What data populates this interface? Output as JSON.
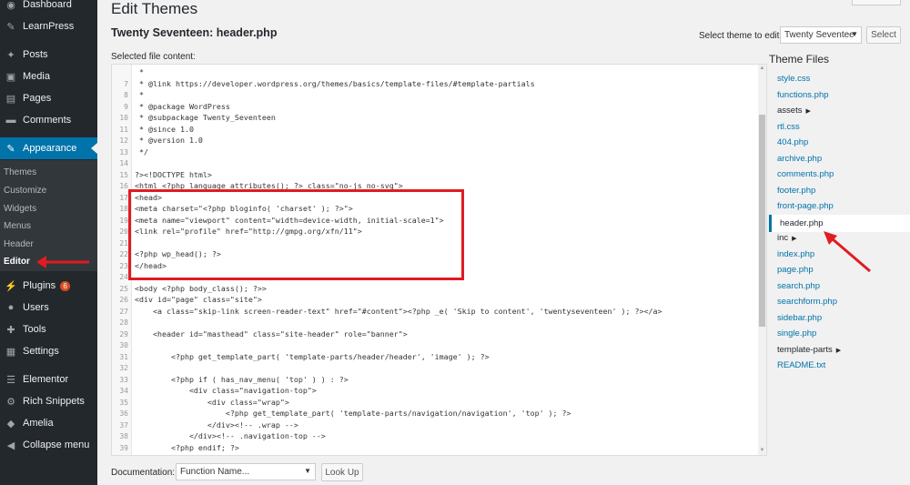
{
  "sidebar": {
    "items": [
      {
        "label": "Dashboard",
        "icon": "dashboard-icon",
        "glyph": "◉"
      },
      {
        "label": "LearnPress",
        "icon": "learnpress-icon",
        "glyph": "✎"
      },
      {
        "label": "Posts",
        "icon": "pin-icon",
        "glyph": "✦"
      },
      {
        "label": "Media",
        "icon": "media-icon",
        "glyph": "▣"
      },
      {
        "label": "Pages",
        "icon": "pages-icon",
        "glyph": "▤"
      },
      {
        "label": "Comments",
        "icon": "comments-icon",
        "glyph": "▬"
      },
      {
        "label": "Appearance",
        "icon": "paintbrush-icon",
        "glyph": "✎"
      },
      {
        "label": "Plugins",
        "icon": "plugin-icon",
        "glyph": "⚡",
        "badge": "6"
      },
      {
        "label": "Users",
        "icon": "users-icon",
        "glyph": "●"
      },
      {
        "label": "Tools",
        "icon": "wrench-icon",
        "glyph": "✚"
      },
      {
        "label": "Settings",
        "icon": "settings-icon",
        "glyph": "▦"
      },
      {
        "label": "Elementor",
        "icon": "elementor-icon",
        "glyph": "☰"
      },
      {
        "label": "Rich Snippets",
        "icon": "rich-snippets-icon",
        "glyph": "⚙"
      },
      {
        "label": "Amelia",
        "icon": "amelia-icon",
        "glyph": "◆"
      },
      {
        "label": "Collapse menu",
        "icon": "collapse-icon",
        "glyph": "◀"
      }
    ],
    "submenu": [
      "Themes",
      "Customize",
      "Widgets",
      "Menus",
      "Header",
      "Editor"
    ]
  },
  "header": {
    "title": "Edit Themes",
    "file_heading": "Twenty Seventeen: header.php",
    "selected_label": "Selected file content:",
    "select_theme_label": "Select theme to edit:",
    "theme_value": "Twenty Seventee",
    "select_button": "Select"
  },
  "code": {
    "lines": [
      {
        "n": "",
        "t": " *"
      },
      {
        "n": "7",
        "t": " * @link https://developer.wordpress.org/themes/basics/template-files/#template-partials"
      },
      {
        "n": "8",
        "t": " *"
      },
      {
        "n": "9",
        "t": " * @package WordPress"
      },
      {
        "n": "10",
        "t": " * @subpackage Twenty_Seventeen"
      },
      {
        "n": "11",
        "t": " * @since 1.0"
      },
      {
        "n": "12",
        "t": " * @version 1.0"
      },
      {
        "n": "13",
        "t": " */"
      },
      {
        "n": "14",
        "t": ""
      },
      {
        "n": "15",
        "t": "?><!DOCTYPE html>"
      },
      {
        "n": "16",
        "t": "<html <?php language_attributes(); ?> class=\"no-js no-svg\">"
      },
      {
        "n": "17",
        "t": "<head>"
      },
      {
        "n": "18",
        "t": "<meta charset=\"<?php bloginfo( 'charset' ); ?>\">"
      },
      {
        "n": "19",
        "t": "<meta name=\"viewport\" content=\"width=device-width, initial-scale=1\">"
      },
      {
        "n": "20",
        "t": "<link rel=\"profile\" href=\"http://gmpg.org/xfn/11\">"
      },
      {
        "n": "21",
        "t": ""
      },
      {
        "n": "22",
        "t": "<?php wp_head(); ?>"
      },
      {
        "n": "23",
        "t": "</head>"
      },
      {
        "n": "24",
        "t": ""
      },
      {
        "n": "25",
        "t": "<body <?php body_class(); ?>>"
      },
      {
        "n": "26",
        "t": "<div id=\"page\" class=\"site\">"
      },
      {
        "n": "27",
        "t": "    <a class=\"skip-link screen-reader-text\" href=\"#content\"><?php _e( 'Skip to content', 'twentyseventeen' ); ?></a>"
      },
      {
        "n": "28",
        "t": ""
      },
      {
        "n": "29",
        "t": "    <header id=\"masthead\" class=\"site-header\" role=\"banner\">"
      },
      {
        "n": "30",
        "t": ""
      },
      {
        "n": "31",
        "t": "        <?php get_template_part( 'template-parts/header/header', 'image' ); ?>"
      },
      {
        "n": "32",
        "t": ""
      },
      {
        "n": "33",
        "t": "        <?php if ( has_nav_menu( 'top' ) ) : ?>"
      },
      {
        "n": "34",
        "t": "            <div class=\"navigation-top\">"
      },
      {
        "n": "35",
        "t": "                <div class=\"wrap\">"
      },
      {
        "n": "36",
        "t": "                    <?php get_template_part( 'template-parts/navigation/navigation', 'top' ); ?>"
      },
      {
        "n": "37",
        "t": "                </div><!-- .wrap -->"
      },
      {
        "n": "38",
        "t": "            </div><!-- .navigation-top -->"
      },
      {
        "n": "39",
        "t": "        <?php endif; ?>"
      }
    ]
  },
  "theme_files": {
    "title": "Theme Files",
    "items": [
      {
        "label": "style.css",
        "folder": false
      },
      {
        "label": "functions.php",
        "folder": false
      },
      {
        "label": "assets",
        "folder": true
      },
      {
        "label": "rtl.css",
        "folder": false
      },
      {
        "label": "404.php",
        "folder": false
      },
      {
        "label": "archive.php",
        "folder": false
      },
      {
        "label": "comments.php",
        "folder": false
      },
      {
        "label": "footer.php",
        "folder": false
      },
      {
        "label": "front-page.php",
        "folder": false
      },
      {
        "label": "header.php",
        "folder": false,
        "active": true
      },
      {
        "label": "inc",
        "folder": true
      },
      {
        "label": "index.php",
        "folder": false
      },
      {
        "label": "page.php",
        "folder": false
      },
      {
        "label": "search.php",
        "folder": false
      },
      {
        "label": "searchform.php",
        "folder": false
      },
      {
        "label": "sidebar.php",
        "folder": false
      },
      {
        "label": "single.php",
        "folder": false
      },
      {
        "label": "template-parts",
        "folder": true
      },
      {
        "label": "README.txt",
        "folder": false
      }
    ]
  },
  "footer": {
    "doc_label": "Documentation:",
    "function_placeholder": "Function Name...",
    "lookup_button": "Look Up"
  },
  "colors": {
    "sidebar_bg": "#23282d",
    "accent": "#0073aa",
    "annotation": "#e01b22",
    "badge": "#d54e21"
  }
}
